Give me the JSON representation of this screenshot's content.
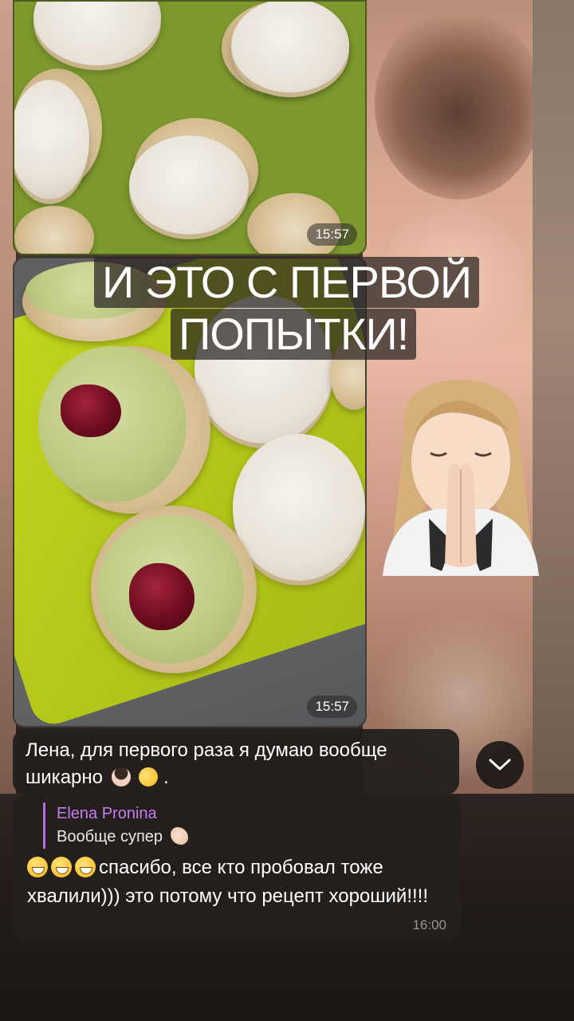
{
  "photos": [
    {
      "time": "15:57"
    },
    {
      "time": "15:57"
    }
  ],
  "overlay": {
    "line1": "И ЭТО С ПЕРВОЙ",
    "line2": "ПОПЫТКИ!"
  },
  "messages": [
    {
      "text": "Лена, для первого раза я думаю вообще шикарно",
      "trailing": "."
    },
    {
      "reply_author": "Elena Pronina",
      "reply_text": "Вообще супер",
      "text": "спасибо, все кто пробовал тоже хвалили))) это потому что рецепт хороший!!!!",
      "time": "16:00"
    }
  ],
  "icons": {
    "scroll": "chevron-down-icon",
    "reaction_face": "facepalm-woman-emoji",
    "laugh": "rolling-laughing-emoji",
    "clap": "clapping-hands-emoji",
    "grin": "grinning-face-emoji"
  }
}
